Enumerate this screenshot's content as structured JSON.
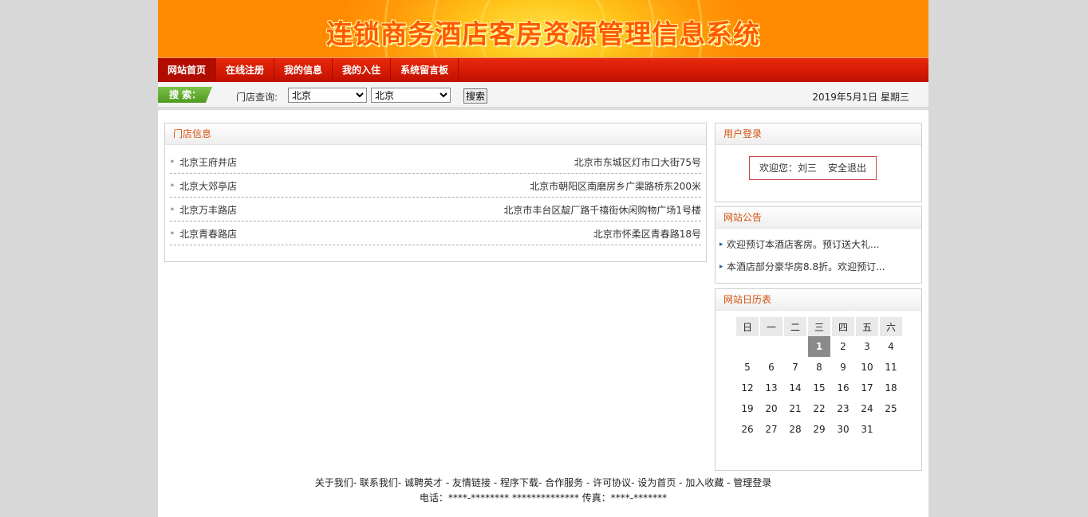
{
  "banner": {
    "title": "连锁商务酒店客房资源管理信息系统"
  },
  "nav": {
    "items": [
      "网站首页",
      "在线注册",
      "我的信息",
      "我的入住",
      "系统留言板"
    ]
  },
  "search": {
    "tag": "搜 索：",
    "label": "门店查询:",
    "select1_value": "北京",
    "select2_value": "北京",
    "button": "搜索",
    "date": "2019年5月1日 星期三"
  },
  "stores": {
    "title": "门店信息",
    "items": [
      {
        "name": "北京王府井店",
        "address": "北京市东城区灯市口大街75号"
      },
      {
        "name": "北京大郊亭店",
        "address": "北京市朝阳区南磨房乡广渠路桥东200米"
      },
      {
        "name": "北京万丰路店",
        "address": "北京市丰台区靛厂路千禧街休闲购物广场1号楼"
      },
      {
        "name": "北京青春路店",
        "address": "北京市怀柔区青春路18号"
      }
    ]
  },
  "login": {
    "title": "用户登录",
    "welcome": "欢迎您：刘三",
    "logout": "安全退出"
  },
  "notice": {
    "title": "网站公告",
    "items": [
      "欢迎预订本酒店客房。预订送大礼...",
      "本酒店部分豪华房8.8折。欢迎预订..."
    ]
  },
  "calendar": {
    "title": "网站日历表",
    "weekdays": [
      "日",
      "一",
      "二",
      "三",
      "四",
      "五",
      "六"
    ],
    "weeks": [
      [
        "",
        "",
        "",
        "1",
        "2",
        "3",
        "4"
      ],
      [
        "5",
        "6",
        "7",
        "8",
        "9",
        "10",
        "11"
      ],
      [
        "12",
        "13",
        "14",
        "15",
        "16",
        "17",
        "18"
      ],
      [
        "19",
        "20",
        "21",
        "22",
        "23",
        "24",
        "25"
      ],
      [
        "26",
        "27",
        "28",
        "29",
        "30",
        "31",
        ""
      ]
    ],
    "today": "1"
  },
  "footer": {
    "links": [
      "关于我们",
      "联系我们",
      "诚聘英才",
      "友情链接",
      "程序下载",
      "合作服务",
      "许可协议",
      "设为首页",
      "加入收藏",
      "管理登录"
    ],
    "separators": [
      "- ",
      "- ",
      " - ",
      " - ",
      "- ",
      " - ",
      "- ",
      " - ",
      " - "
    ],
    "contact": "电话：****-******** ************** 传真：****-*******"
  }
}
